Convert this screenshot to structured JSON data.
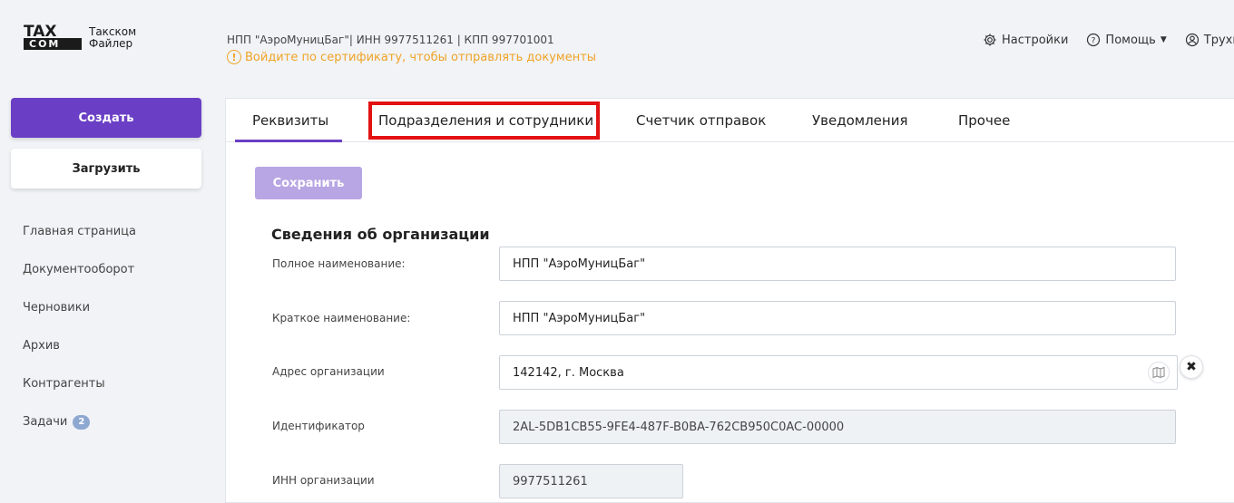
{
  "app": {
    "logo_tax": "TAX",
    "logo_com": "COM",
    "logo_name_line1": "Такском",
    "logo_name_line2": "Файлер"
  },
  "header": {
    "org_info": "НПП \"АэроМуницБаг\"| ИНН 9977511261 | КПП 997701001",
    "warning_icon": "!",
    "warning_text": "Войдите по сертификату, чтобы отправлять документы",
    "nav": {
      "settings": "Настройки",
      "help": "Помощь",
      "user": "Трухи"
    }
  },
  "sidebar": {
    "create_label": "Создать",
    "upload_label": "Загрузить",
    "items": [
      {
        "label": "Главная страница"
      },
      {
        "label": "Документооборот"
      },
      {
        "label": "Черновики"
      },
      {
        "label": "Архив"
      },
      {
        "label": "Контрагенты"
      },
      {
        "label": "Задачи",
        "badge": "2"
      }
    ]
  },
  "tabs": [
    {
      "label": "Реквизиты",
      "active": true
    },
    {
      "label": "Подразделения и сотрудники",
      "highlighted": true
    },
    {
      "label": "Счетчик отправок"
    },
    {
      "label": "Уведомления"
    },
    {
      "label": "Прочее"
    }
  ],
  "form": {
    "save_label": "Сохранить",
    "section_title": "Сведения об организации",
    "full_name_label": "Полное наименование:",
    "full_name_value": "НПП \"АэроМуницБаг\"",
    "short_name_label": "Краткое наименование:",
    "short_name_value": "НПП \"АэроМуницБаг\"",
    "address_label": "Адрес организации",
    "address_value": "142142, г. Москва",
    "clear_symbol": "✖",
    "id_label": "Идентификатор",
    "id_value": "2AL-5DB1CB55-9FE4-487F-B0BA-762CB950C0AC-00000",
    "inn_label": "ИНН организации",
    "inn_value": "9977511261"
  },
  "colors": {
    "accent": "#6a3fc5",
    "warning": "#f0a326",
    "highlight": "#e31212"
  }
}
